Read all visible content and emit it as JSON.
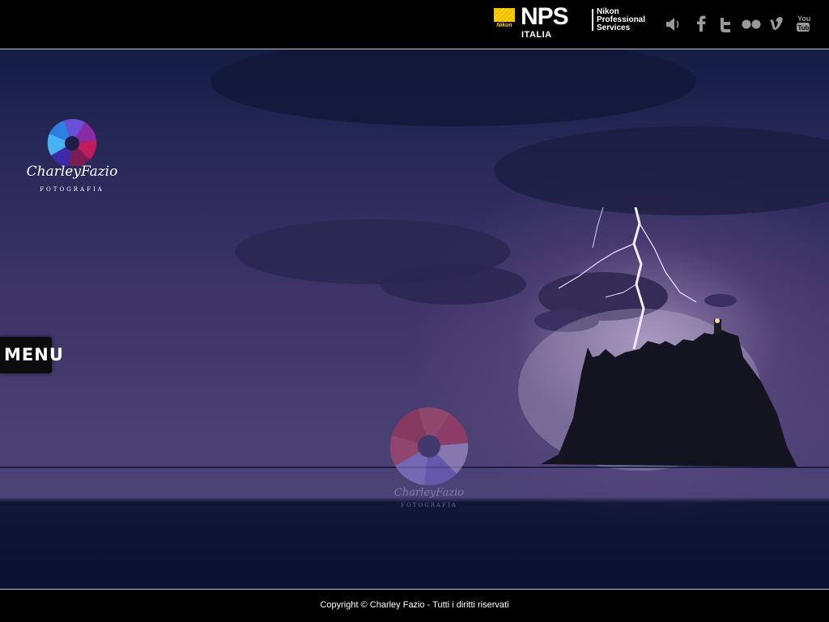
{
  "header": {
    "nikon_badge_text": "Nikon",
    "nps_title": "NPS",
    "nps_region": "ITALIA",
    "nps_services": [
      "Nikon",
      "Professional",
      "Services"
    ],
    "social_icons": [
      "speaker-icon",
      "facebook-icon",
      "twitter-icon",
      "flickr-icon",
      "vimeo-icon",
      "youtube-icon"
    ]
  },
  "logo": {
    "name": "CharleyFazio",
    "tagline": "FOTOGRAFIA"
  },
  "watermark": {
    "name": "CharleyFazio",
    "tagline": "FOTOGRAFIA"
  },
  "menu": {
    "label": "MENU"
  },
  "footer": {
    "copyright": "Copyright © Charley Fazio - Tutti i diritti riservati"
  },
  "colors": {
    "background": "#000000",
    "nikon_yellow": "#ffd400",
    "sky": "#3d3366",
    "sea": "#0b1131"
  }
}
